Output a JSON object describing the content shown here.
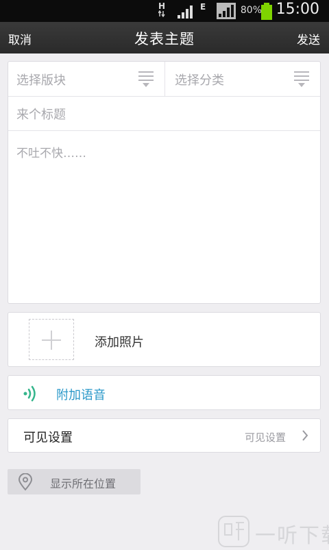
{
  "status_bar": {
    "network_h": "H",
    "network_e": "E",
    "battery_percent": "80%",
    "time": "15:00"
  },
  "header": {
    "cancel_label": "取消",
    "title": "发表主题",
    "send_label": "发送"
  },
  "form": {
    "board_select_placeholder": "选择版块",
    "category_select_placeholder": "选择分类",
    "title_placeholder": "来个标题",
    "body_placeholder": "不吐不快……"
  },
  "photo": {
    "label": "添加照片"
  },
  "voice": {
    "label": "附加语音",
    "color": "#2a98c9"
  },
  "visibility": {
    "label": "可见设置",
    "value": "可见设置"
  },
  "location": {
    "label": "显示所在位置"
  },
  "watermark": {
    "text": "一听下载"
  },
  "icons": [
    "hamburger-menu-icon",
    "plus-icon",
    "sound-wave-icon",
    "chevron-right-icon",
    "location-pin-icon"
  ]
}
